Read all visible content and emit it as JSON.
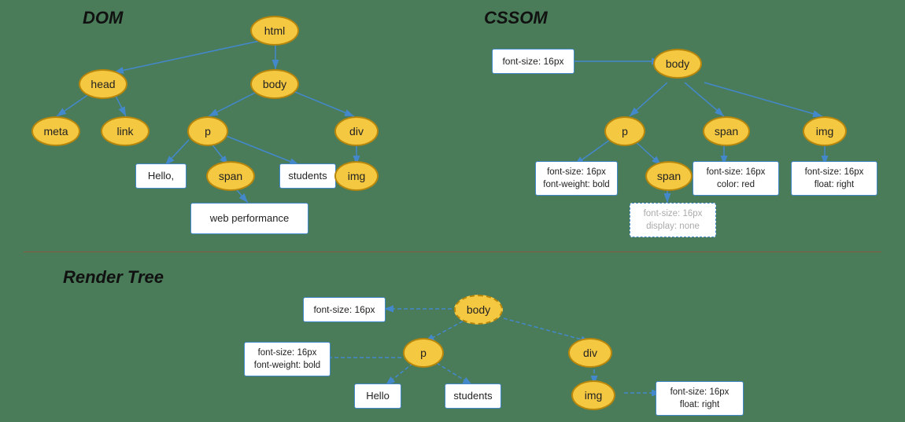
{
  "sections": {
    "dom": {
      "label": "DOM"
    },
    "cssom": {
      "label": "CSSOM"
    },
    "render_tree": {
      "label": "Render Tree"
    }
  },
  "dom_nodes": {
    "html": "html",
    "head": "head",
    "body": "body",
    "meta": "meta",
    "link": "link",
    "p": "p",
    "div": "div",
    "span": "span",
    "img": "img",
    "hello": "Hello,",
    "students": "students",
    "web_performance": "web performance"
  },
  "cssom_nodes": {
    "body": "body",
    "p": "p",
    "span_outer": "span",
    "img": "img",
    "span_inner": "span",
    "font_size_body": "font-size: 16px",
    "font_size_p": "font-size: 16px\nfont-weight: bold",
    "font_size_span_outer": "font-size: 16px\ncolor: red",
    "font_size_img": "font-size: 16px\nfloat: right",
    "font_size_span_inner": "font-size: 16px\ndisplay: none"
  },
  "render_nodes": {
    "body": "body",
    "p": "p",
    "div": "div",
    "img": "img",
    "hello": "Hello",
    "students": "students",
    "font_size_top": "font-size: 16px",
    "font_size_p": "font-size: 16px\nfont-weight: bold",
    "font_size_img": "font-size: 16px\nfloat: right"
  }
}
